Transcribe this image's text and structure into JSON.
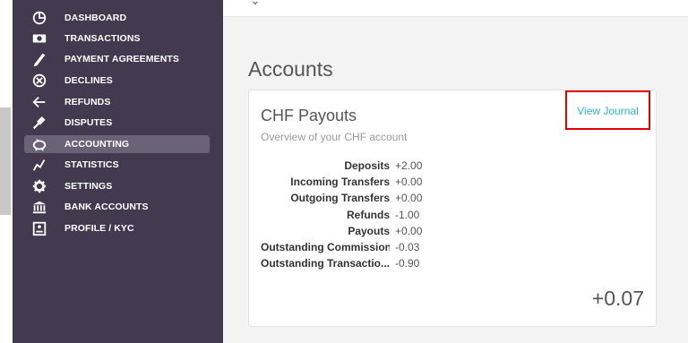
{
  "sidebar": {
    "items": [
      {
        "label": "DASHBOARD",
        "icon": "dashboard-icon",
        "active": false
      },
      {
        "label": "TRANSACTIONS",
        "icon": "money-icon",
        "active": false
      },
      {
        "label": "PAYMENT AGREEMENTS",
        "icon": "pen-icon",
        "active": false
      },
      {
        "label": "DECLINES",
        "icon": "cancel-circle-icon",
        "active": false
      },
      {
        "label": "REFUNDS",
        "icon": "refund-arrow-icon",
        "active": false
      },
      {
        "label": "DISPUTES",
        "icon": "gavel-icon",
        "active": false
      },
      {
        "label": "ACCOUNTING",
        "icon": "piggy-bank-icon",
        "active": true
      },
      {
        "label": "STATISTICS",
        "icon": "chart-line-icon",
        "active": false
      },
      {
        "label": "SETTINGS",
        "icon": "gear-icon",
        "active": false
      },
      {
        "label": "BANK ACCOUNTS",
        "icon": "bank-icon",
        "active": false
      },
      {
        "label": "PROFILE / KYC",
        "icon": "id-card-icon",
        "active": false
      }
    ]
  },
  "main": {
    "title": "Accounts",
    "card": {
      "title": "CHF Payouts",
      "subtitle": "Overview of your CHF account",
      "link": "View Journal",
      "rows": [
        {
          "label": "Deposits",
          "value": "+2.00"
        },
        {
          "label": "Incoming Transfers",
          "value": "+0.00"
        },
        {
          "label": "Outgoing Transfers",
          "value": "+0.00"
        },
        {
          "label": "Refunds",
          "value": "-1.00"
        },
        {
          "label": "Payouts",
          "value": "+0.00"
        },
        {
          "label": "Outstanding Commission",
          "value": "-0.03"
        },
        {
          "label": "Outstanding Transactio...",
          "value": "-0.90"
        }
      ],
      "total": "+0.07"
    }
  },
  "colors": {
    "sidebar_bg": "#433a4f",
    "active_bg": "#6a6275",
    "link": "#29b6d6",
    "highlight_box": "#e00000"
  }
}
